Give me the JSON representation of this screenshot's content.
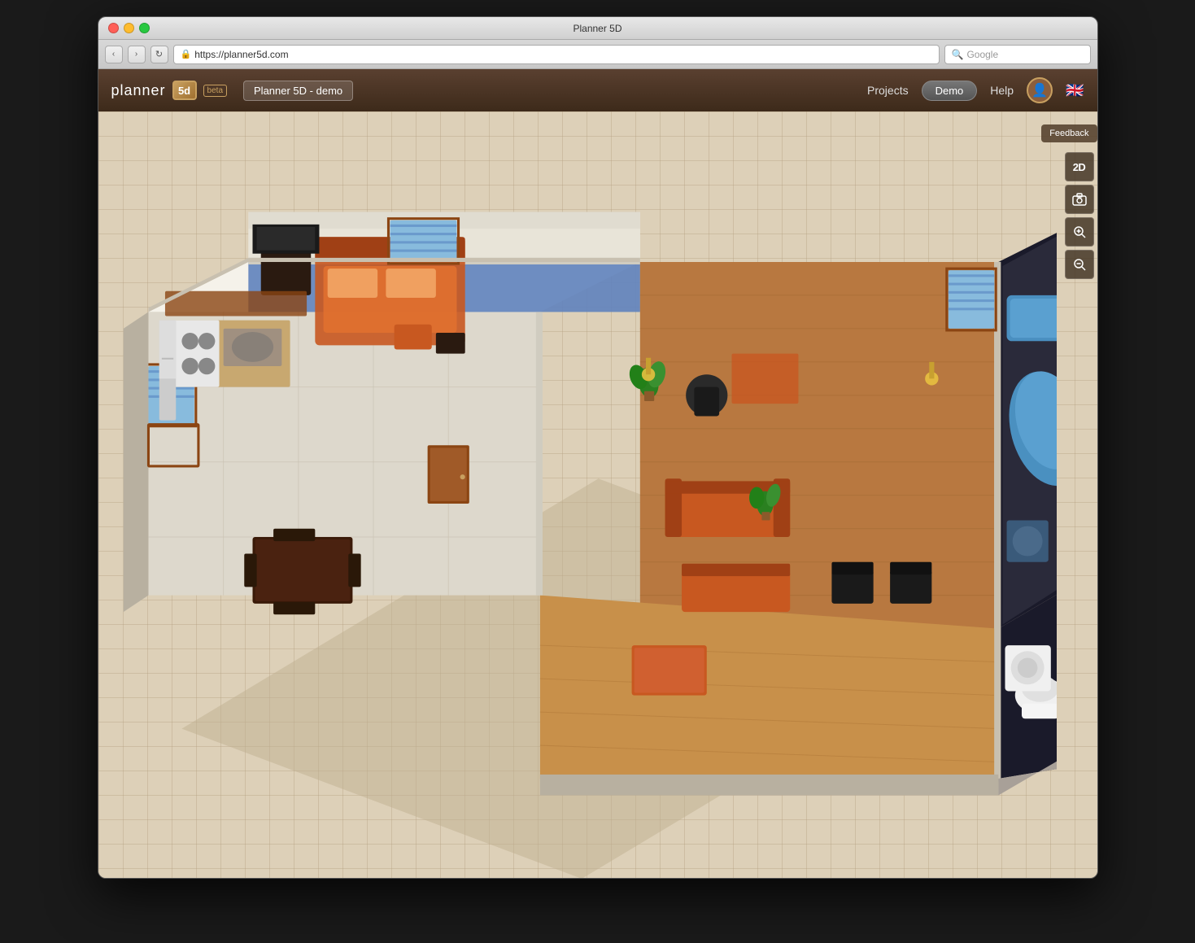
{
  "window": {
    "title": "Planner 5D",
    "controls": {
      "close": "close",
      "minimize": "minimize",
      "maximize": "maximize"
    }
  },
  "browser": {
    "url": "https://planner5d.com",
    "url_icon": "🔒",
    "search_placeholder": "Google",
    "back_label": "‹",
    "forward_label": "›",
    "refresh_label": "↻"
  },
  "header": {
    "logo_text": "planner",
    "logo_5d": "5d",
    "beta_label": "beta",
    "project_name": "Planner 5D - demo",
    "nav_items": [
      "Projects",
      "Demo",
      "Help"
    ],
    "demo_label": "Demo",
    "projects_label": "Projects",
    "help_label": "Help",
    "flag": "🇬🇧"
  },
  "toolbar": {
    "feedback_label": "Feedback",
    "view_2d_label": "2D",
    "camera_icon": "📷",
    "zoom_in_icon": "+🔍",
    "zoom_out_icon": "🔍"
  },
  "colors": {
    "header_bg": "#3d2a1a",
    "toolbar_bg": "#2a1a0a",
    "accent": "#c8a060",
    "grid_bg": "#ddd0b8",
    "wall_color": "#f5f0e8",
    "floor_wood": "#b8834a",
    "floor_tile": "#d8d0c0",
    "floor_blue": "#5a7ab8",
    "furniture_orange": "#c85820",
    "furniture_dark": "#3a2010"
  }
}
